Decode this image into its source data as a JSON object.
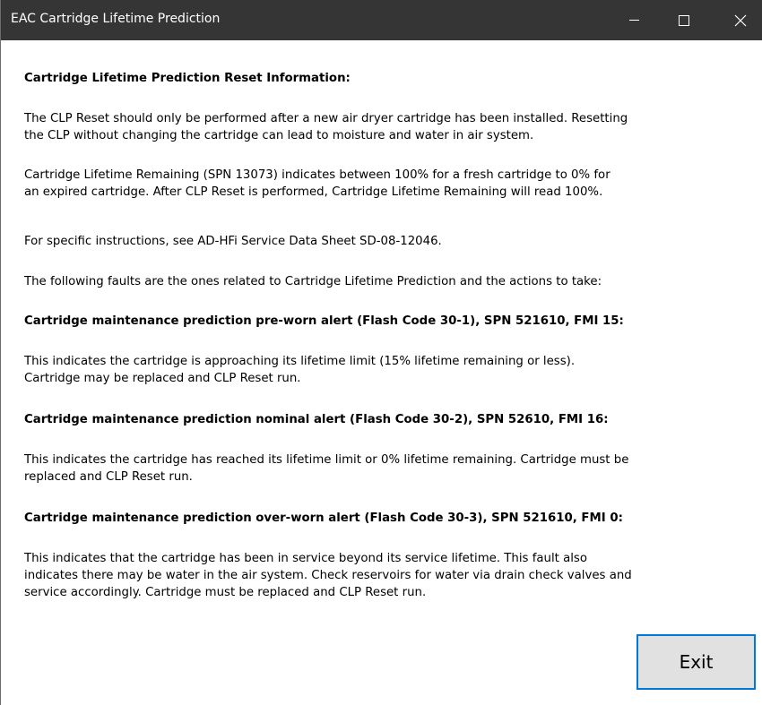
{
  "window": {
    "title": "EAC Cartridge Lifetime Prediction",
    "controls": {
      "minimize": "minimize-icon",
      "maximize": "maximize-icon",
      "close": "close-icon"
    }
  },
  "content": {
    "heading": "Cartridge Lifetime Prediction Reset Information:",
    "para1": [
      "The CLP Reset should only be performed after a new air dryer cartridge has been installed. Resetting",
      "the CLP without changing the cartridge can lead to moisture and water in air system."
    ],
    "para2": [
      "Cartridge Lifetime Remaining (SPN 13073) indicates between 100% for a fresh cartridge to 0% for",
      "an expired cartridge. After CLP Reset is performed, Cartridge Lifetime Remaining will read 100%."
    ],
    "para3": [
      "For specific instructions, see AD-HFi Service Data Sheet SD-08-12046."
    ],
    "para4": [
      "The following faults are the ones related to Cartridge Lifetime Prediction and the actions to take:"
    ],
    "fault1_heading": "Cartridge maintenance prediction pre-worn alert (Flash Code 30-1), SPN 521610, FMI 15:",
    "fault1_text": [
      "This indicates the cartridge is approaching its lifetime limit (15% lifetime remaining or less).",
      "Cartridge may be replaced and CLP Reset run."
    ],
    "fault2_heading": "Cartridge maintenance prediction nominal alert (Flash Code 30-2), SPN 52610, FMI 16:",
    "fault2_text": [
      "This indicates the cartridge has reached its lifetime limit or 0% lifetime remaining. Cartridge must be",
      "replaced and CLP Reset run."
    ],
    "fault3_heading": "Cartridge maintenance prediction over-worn alert (Flash Code 30-3), SPN 521610, FMI 0:",
    "fault3_text": [
      "This indicates that the cartridge has been in service beyond its service lifetime. This fault also",
      "indicates there may be water in the air system. Check reservoirs for water via drain check valves and",
      "service accordingly. Cartridge must be replaced and CLP Reset run."
    ]
  },
  "buttons": {
    "exit_label": "Exit"
  },
  "colors": {
    "titlebar": "#353535",
    "button_border": "#0078d7",
    "button_face": "#e1e1e1"
  }
}
